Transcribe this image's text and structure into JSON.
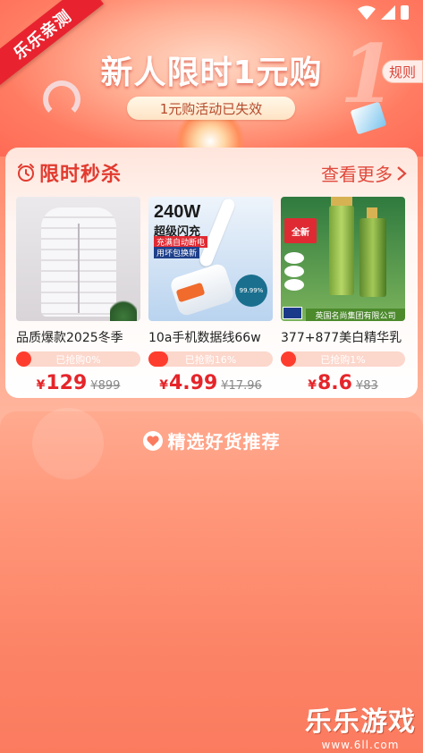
{
  "ribbon": {
    "text": "乐乐亲测"
  },
  "banner": {
    "title": "新人限时1元购",
    "big_digit": "1",
    "rules_label": "规则",
    "expired_label": "1元购活动已失效"
  },
  "flash_sale": {
    "title": "限时秒杀",
    "more_label": "查看更多",
    "products": [
      {
        "name": "品质爆款2025冬季",
        "sold_label": "已抢购0%",
        "sold_percent": 0,
        "currency": "¥",
        "price": "129",
        "original_price": "¥899"
      },
      {
        "name": "10a手机数据线66w",
        "sold_label": "已抢购16%",
        "sold_percent": 16,
        "currency": "¥",
        "price": "4.99",
        "original_price": "¥17.96",
        "image_text": {
          "headline": "240W",
          "subline": "超级闪充",
          "tag_red": "充满自动断电",
          "tag_blue": "用坏包换新",
          "badge": "99.99%"
        }
      },
      {
        "name": "377+877美白精华乳",
        "sold_label": "已抢购1%",
        "sold_percent": 1,
        "currency": "¥",
        "price": "8.6",
        "original_price": "¥83",
        "image_text": {
          "badge": "全新",
          "footer": "英国名尚集团有限公司"
        }
      }
    ]
  },
  "recommend": {
    "title": "精选好货推荐"
  },
  "watermark": {
    "name": "乐乐游戏",
    "url": "www.6ll.com"
  },
  "colors": {
    "accent_red": "#e23a2f",
    "price_red": "#e5252a",
    "progress_fill": "#ff3d2e",
    "progress_track": "#fcd7cc"
  }
}
